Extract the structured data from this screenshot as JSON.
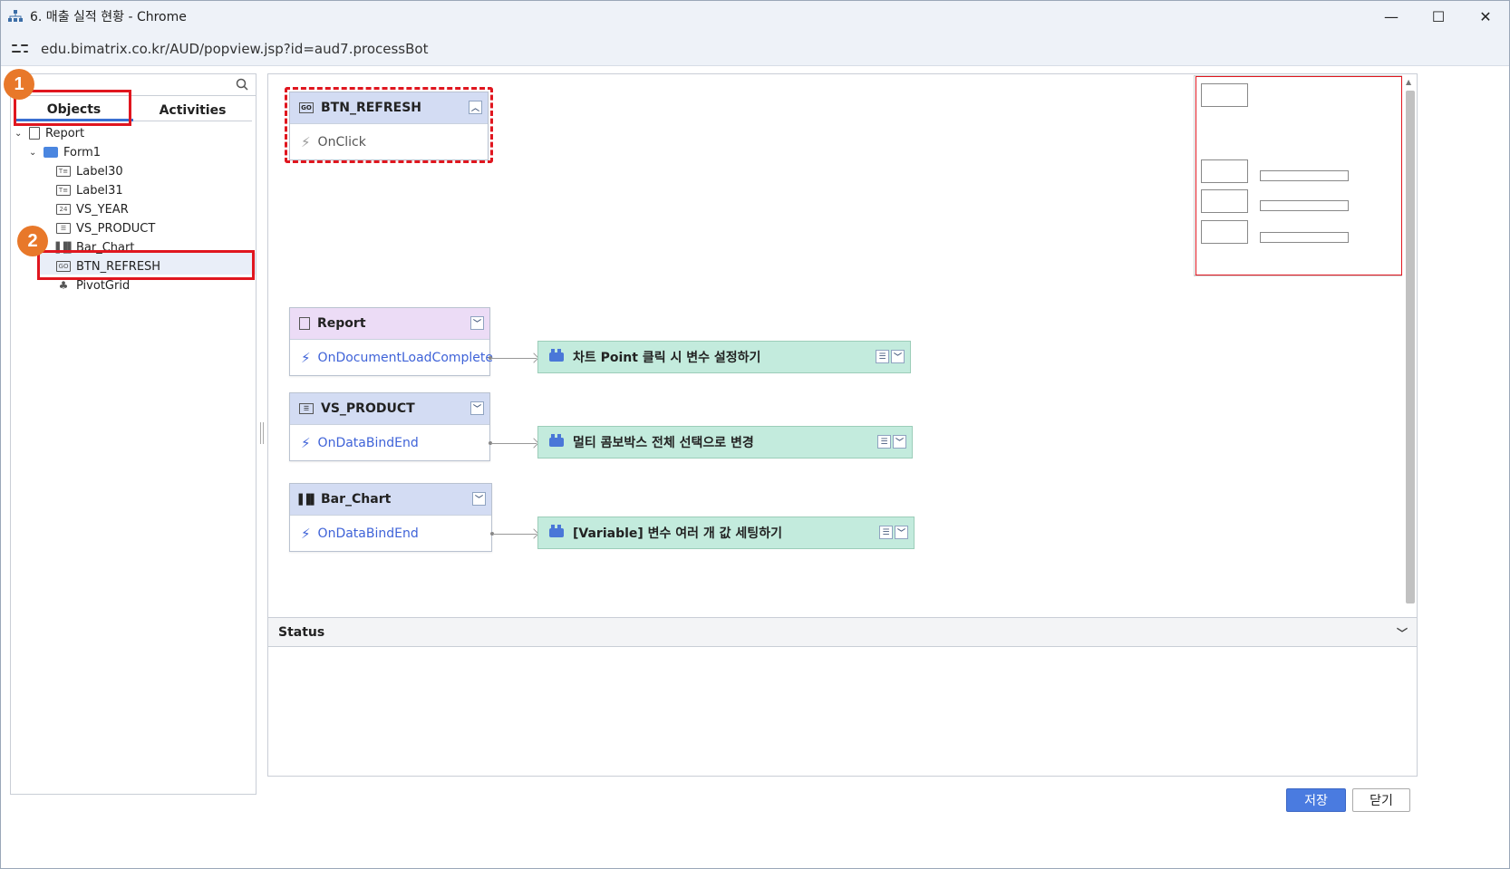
{
  "window": {
    "title": "6. 매출 실적 현황 - Chrome",
    "url": "edu.bimatrix.co.kr/AUD/popview.jsp?id=aud7.processBot"
  },
  "left": {
    "tabs": [
      {
        "label": "Objects",
        "active": true
      },
      {
        "label": "Activities",
        "active": false
      }
    ],
    "badges": [
      "1",
      "2"
    ],
    "tree": [
      {
        "label": "Report",
        "icon": "document-icon"
      },
      {
        "label": "Form1",
        "icon": "folder-icon"
      },
      {
        "label": "Label30",
        "icon": "label-icon"
      },
      {
        "label": "Label31",
        "icon": "label-icon"
      },
      {
        "label": "VS_YEAR",
        "icon": "calendar-icon"
      },
      {
        "label": "VS_PRODUCT",
        "icon": "combobox-icon"
      },
      {
        "label": "Bar_Chart",
        "icon": "bar-chart-icon"
      },
      {
        "label": "BTN_REFRESH",
        "icon": "button-icon",
        "selected": true
      },
      {
        "label": "PivotGrid",
        "icon": "pivot-icon"
      }
    ]
  },
  "canvas": {
    "objects": [
      {
        "name": "BTN_REFRESH",
        "event": "OnClick",
        "icon": "button-icon"
      },
      {
        "name": "Report",
        "event": "OnDocumentLoadComplete",
        "icon": "document-icon",
        "activity": "차트 Point 클릭 시 변수 설정하기"
      },
      {
        "name": "VS_PRODUCT",
        "event": "OnDataBindEnd",
        "icon": "combobox-icon",
        "activity": "멀티 콤보박스 전체 선택으로 변경"
      },
      {
        "name": "Bar_Chart",
        "event": "OnDataBindEnd",
        "icon": "bar-chart-icon",
        "activity": "[Variable] 변수 여러 개 값 세팅하기"
      }
    ]
  },
  "status": {
    "title": "Status"
  },
  "footer": {
    "save_label": "저장",
    "close_label": "닫기"
  },
  "colors": {
    "accent": "#4a7be0",
    "highlight": "#e0161f",
    "activity_bg": "#c3ebdd",
    "badge": "#e8782a"
  }
}
